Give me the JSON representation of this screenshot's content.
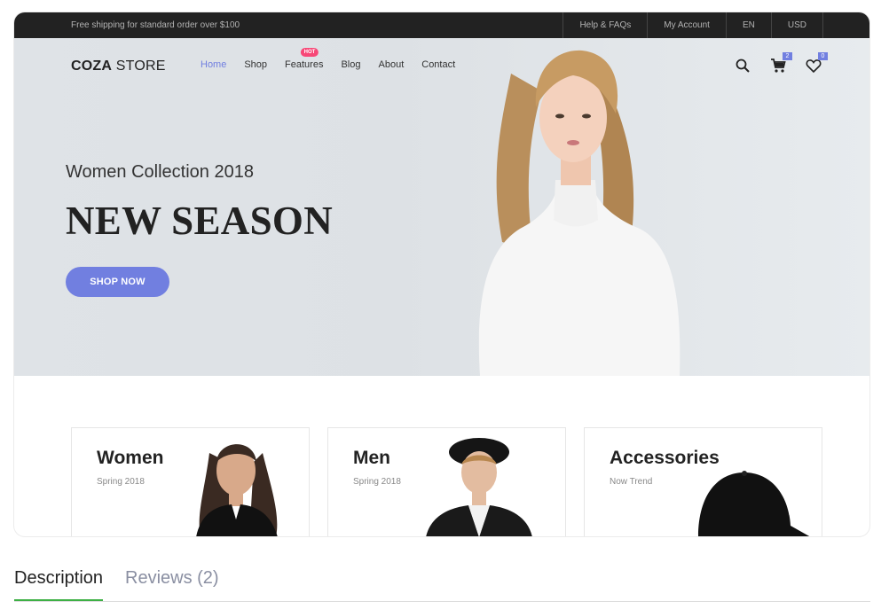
{
  "topbar": {
    "shipping_text": "Free shipping for standard order over $100",
    "links": [
      "Help & FAQs",
      "My Account",
      "EN",
      "USD"
    ]
  },
  "header": {
    "logo_bold": "COZA",
    "logo_light": "STORE",
    "nav": [
      {
        "label": "Home",
        "active": true
      },
      {
        "label": "Shop",
        "active": false
      },
      {
        "label": "Features",
        "active": false,
        "badge": "HOT"
      },
      {
        "label": "Blog",
        "active": false
      },
      {
        "label": "About",
        "active": false
      },
      {
        "label": "Contact",
        "active": false
      }
    ],
    "cart_count": "2",
    "wishlist_count": "0"
  },
  "hero": {
    "subtitle": "Women Collection 2018",
    "title": "NEW SEASON",
    "cta": "SHOP NOW"
  },
  "categories": [
    {
      "title": "Women",
      "subtitle": "Spring 2018"
    },
    {
      "title": "Men",
      "subtitle": "Spring 2018"
    },
    {
      "title": "Accessories",
      "subtitle": "Now Trend"
    }
  ],
  "tabs": {
    "description": "Description",
    "reviews": "Reviews (2)"
  },
  "colors": {
    "accent": "#717fe0",
    "hot_badge": "#f74877",
    "topbar_bg": "#222222",
    "tab_underline": "#3db045"
  }
}
